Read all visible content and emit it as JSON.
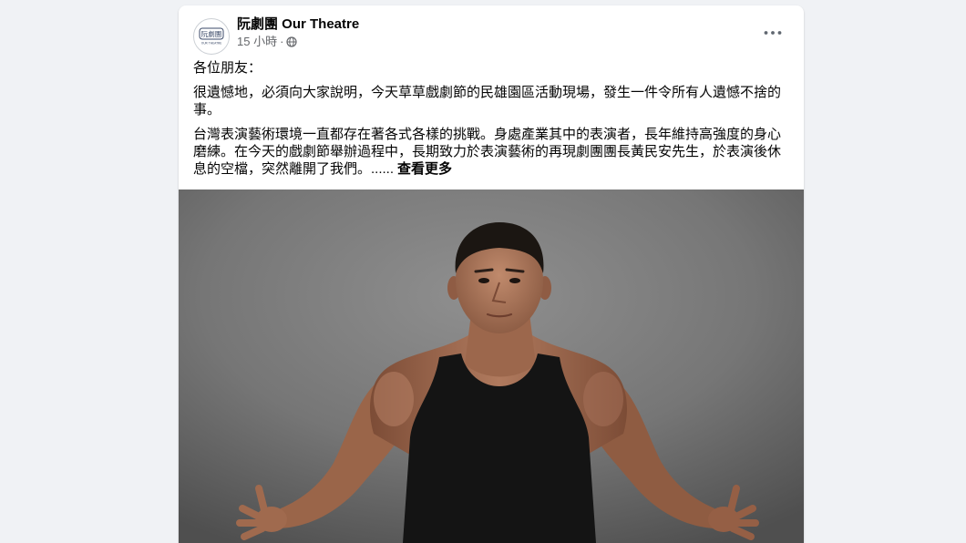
{
  "colors": {
    "page_background": "#f0f2f5",
    "card_background": "#ffffff",
    "primary_text": "#050505",
    "secondary_text": "#65676b"
  },
  "post": {
    "author": {
      "name": "阮劇團 Our Theatre",
      "avatar": {
        "logo_text": "阮劇團",
        "logo_subtext": "OUR THEATRE"
      }
    },
    "timestamp": "15 小時",
    "separator": "·",
    "audience_icon": "globe-icon",
    "more_options_icon": "more-options-icon",
    "body": {
      "paragraphs": [
        "各位朋友：",
        "很遺憾地，必須向大家說明，今天草草戲劇節的民雄園區活動現場，發生一件令所有人遺憾不捨的事。",
        "台灣表演藝術環境一直都存在著各式各樣的挑戰。身處產業其中的表演者，長年維持高強度的身心磨練。在今天的戲劇節舉辦過程中，長期致力於表演藝術的再現劇團團長黃民安先生，於表演後休息的空檔，突然離開了我們。......"
      ],
      "see_more": "查看更多"
    }
  }
}
